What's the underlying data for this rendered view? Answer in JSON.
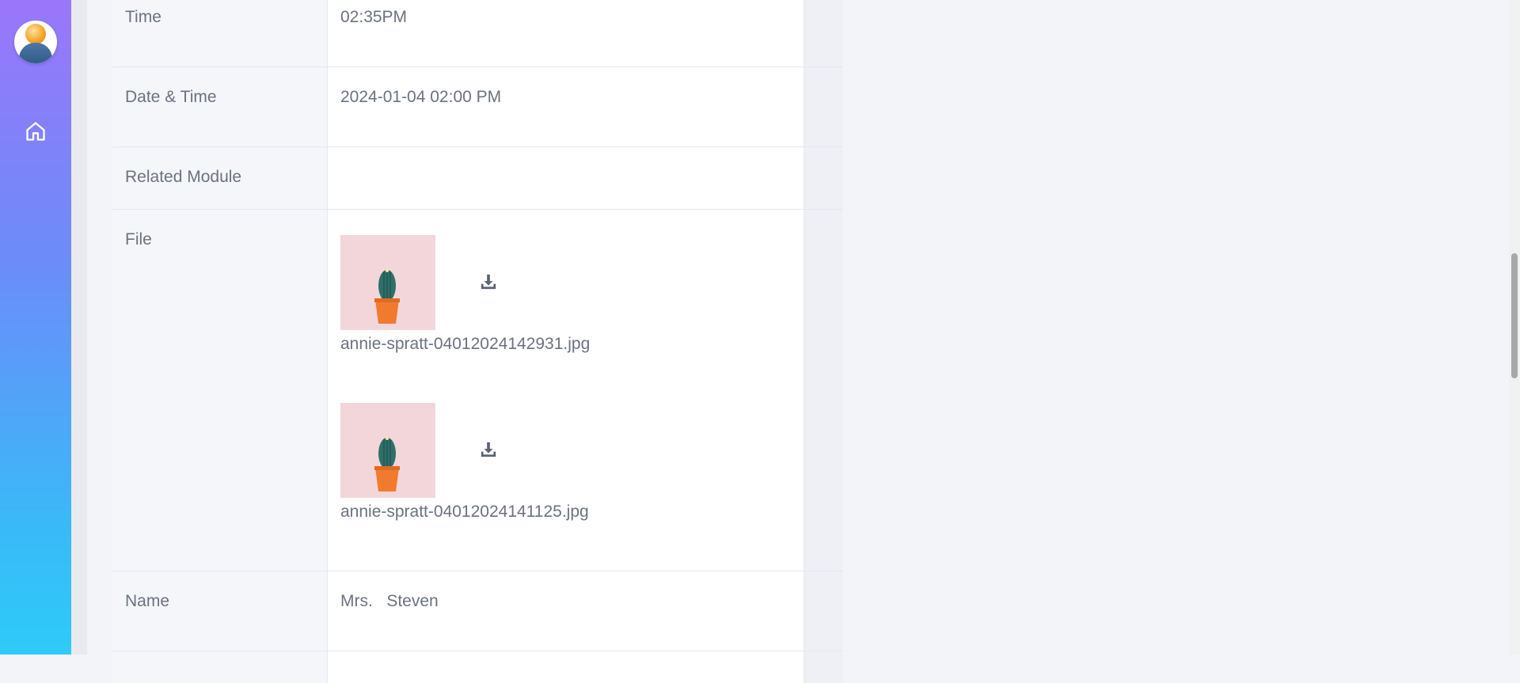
{
  "sidebar": {
    "avatar_icon": "user-avatar-icon",
    "home_icon": "home-icon",
    "gradient": [
      "#9a76fb",
      "#2dcbf8"
    ]
  },
  "rows": {
    "time": {
      "label": "Time",
      "value": "02:35PM"
    },
    "datetime": {
      "label": "Date & Time",
      "value": "2024-01-04 02:00 PM"
    },
    "related": {
      "label": "Related Module",
      "value": ""
    },
    "file": {
      "label": "File",
      "items": [
        {
          "filename": "annie-spratt-04012024142931.jpg",
          "download_icon": "download-icon"
        },
        {
          "filename": "annie-spratt-04012024141125.jpg",
          "download_icon": "download-icon"
        }
      ]
    },
    "name": {
      "label": "Name",
      "value": "Mrs.   Steven"
    }
  }
}
